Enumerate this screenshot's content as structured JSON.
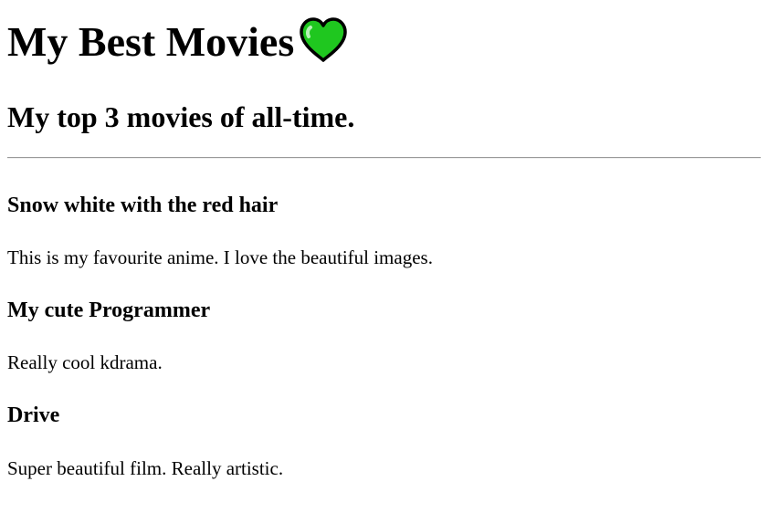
{
  "header": {
    "title": "My Best Movies",
    "heart_color": "#1fc71f",
    "heart_icon": "green-heart-icon"
  },
  "subtitle": "My top 3 movies of all-time.",
  "movies": [
    {
      "title": "Snow white with the red hair",
      "description": "This is my favourite anime. I love the beautiful images."
    },
    {
      "title": "My cute Programmer",
      "description": "Really cool kdrama."
    },
    {
      "title": "Drive",
      "description": "Super beautiful film. Really artistic."
    }
  ]
}
